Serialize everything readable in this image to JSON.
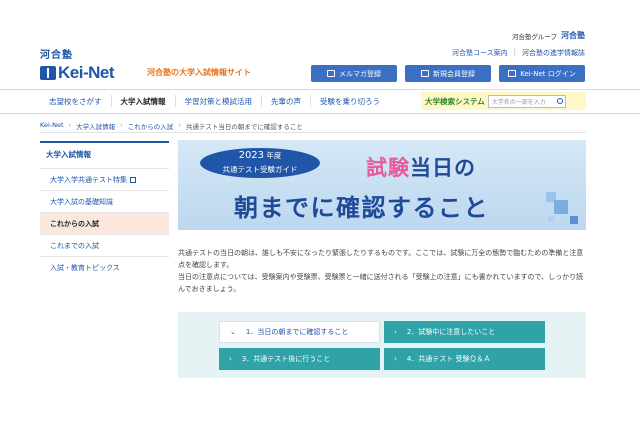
{
  "group_bar": {
    "prefix": "河合塾グループ",
    "brand": "河合塾"
  },
  "logo": {
    "kawai": "河合塾",
    "keinet": "Kei-Net"
  },
  "tagline": "河合塾の大学入試情報サイト",
  "top_links": [
    "河合塾コース案内",
    "河合塾の進学情報誌"
  ],
  "header_buttons": [
    {
      "label": "メルマガ登録",
      "icon": "mail-icon"
    },
    {
      "label": "新規会員登録",
      "icon": "user-icon"
    },
    {
      "label": "Kei-Net ログイン",
      "icon": "login-icon"
    }
  ],
  "nav": [
    "志望校をさがす",
    "大学入試情報",
    "学習対策と模試活用",
    "先輩の声",
    "受験を乗り切ろう"
  ],
  "search": {
    "label": "大学検索システム",
    "placeholder": "大学名の一部を入力"
  },
  "breadcrumb": [
    "Kei-Net",
    "大学入試情報",
    "これからの入試",
    "共通テスト当日の朝までに確認すること"
  ],
  "sidebar": {
    "heading": "大学入試情報",
    "items": [
      "大学入学共通テスト特集",
      "大学入試の基礎知識",
      "これからの入試",
      "これまでの入試",
      "入試・教育トピックス"
    ]
  },
  "banner": {
    "year": "2023",
    "year_suffix": "年度",
    "guide": "共通テスト受験ガイド",
    "title_highlight": "試験",
    "title_rest": "当日の",
    "title_line2": "朝までに確認すること"
  },
  "body": {
    "p1": "共通テストの当日の朝は、誰しも不安になったり緊張したりするものです。ここでは、試験に万全の態勢で臨むための準備と注意点を確認します。",
    "p2": "当日の注意点については、受験案内や受験票、受験票と一緒に送付される「受験上の注意」にも書かれていますので、しっかり読んでおきましょう。"
  },
  "toc": [
    "1．当日の朝までに確認すること",
    "2．試験中に注意したいこと",
    "3．共通テスト後に行うこと",
    "4．共通テスト 受験Ｑ＆Ａ"
  ],
  "colors": {
    "brand": "#1f56a8",
    "accent": "#e8731a",
    "teal": "#2fa3a8",
    "pink": "#e85a9c"
  }
}
